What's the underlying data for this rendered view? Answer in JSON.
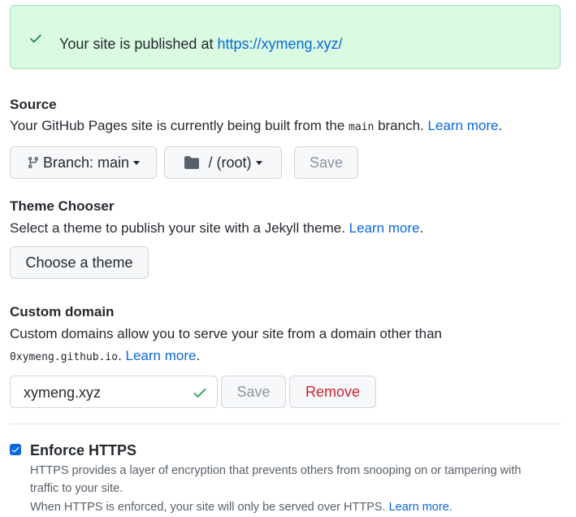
{
  "flash": {
    "message_prefix": "Your site is published at ",
    "url": "https://xymeng.xyz/",
    "icon": "check-icon"
  },
  "source": {
    "heading": "Source",
    "desc_prefix": "Your GitHub Pages site is currently being built from the ",
    "branch_code": "main",
    "desc_suffix": " branch. ",
    "learn_more": "Learn more",
    "period": ".",
    "branch_button": "Branch: main",
    "folder_button": "/ (root)",
    "save_button": "Save"
  },
  "theme": {
    "heading": "Theme Chooser",
    "desc": "Select a theme to publish your site with a Jekyll theme. ",
    "learn_more": "Learn more",
    "period": ".",
    "button": "Choose a theme"
  },
  "domain": {
    "heading": "Custom domain",
    "desc": "Custom domains allow you to serve your site from a domain other than",
    "code": "0xymeng.github.io",
    "after_code": ". ",
    "learn_more": "Learn more",
    "period": ".",
    "input_value": "xymeng.xyz",
    "save_button": "Save",
    "remove_button": "Remove"
  },
  "https": {
    "checked": true,
    "label": "Enforce HTTPS",
    "note_line1": "HTTPS provides a layer of encryption that prevents others from snooping on or tampering with",
    "note_line2": "traffic to your site.",
    "note_line3": "When HTTPS is enforced, your site will only be served over HTTPS. ",
    "learn_more": "Learn more",
    "period": "."
  },
  "colors": {
    "success_bg": "#dafbe1",
    "success_icon": "#1a7f37",
    "link": "#0969da",
    "danger": "#cf222e",
    "check_ok": "#2da44e"
  }
}
